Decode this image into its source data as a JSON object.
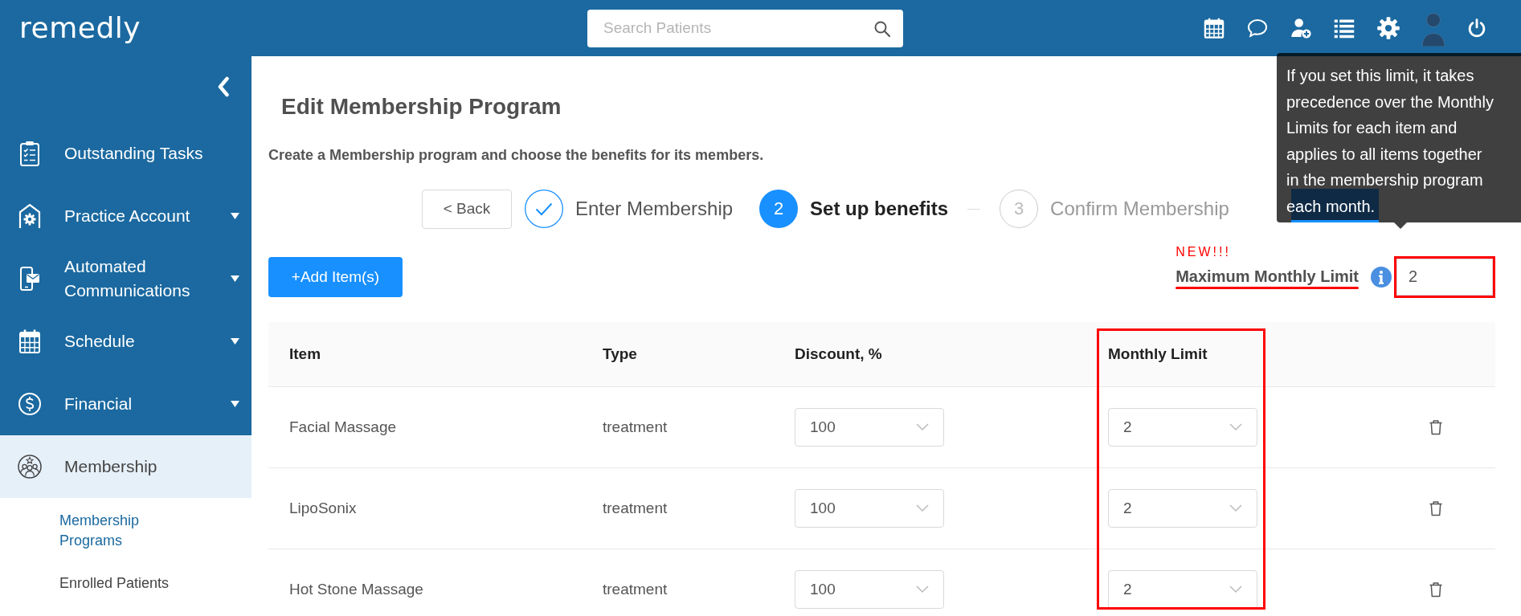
{
  "header": {
    "logo": "remedly",
    "search": {
      "placeholder": "Search Patients"
    }
  },
  "sidebar": {
    "items": [
      {
        "label": "Outstanding Tasks",
        "selected": false,
        "expandable": false
      },
      {
        "label": "Practice Account",
        "selected": false,
        "expandable": true
      },
      {
        "label": "Automated Communications",
        "selected": false,
        "expandable": true
      },
      {
        "label": "Schedule",
        "selected": false,
        "expandable": true
      },
      {
        "label": "Financial",
        "selected": false,
        "expandable": true
      },
      {
        "label": "Membership",
        "selected": true,
        "expandable": false,
        "children": [
          {
            "label": "Membership Programs",
            "selected": true
          },
          {
            "label": "Enrolled Patients",
            "selected": false
          }
        ]
      }
    ]
  },
  "page": {
    "title": "Edit Membership Program",
    "subtitle": "Create a Membership program and choose the benefits for its members.",
    "back_button": "< Back",
    "steps": [
      {
        "label": "Enter Membership",
        "completed": true,
        "selected": false
      },
      {
        "number": "2",
        "label": "Set up benefits",
        "completed": false,
        "selected": true
      },
      {
        "number": "3",
        "label": "Confirm Membership",
        "completed": false,
        "selected": false
      }
    ],
    "add_button": "+Add Item(s)",
    "max_limit": {
      "badge": "NEW!!!",
      "label": "Maximum Monthly Limit",
      "value": "2",
      "highlighted": true
    },
    "tooltip": "If you set this limit, it takes precedence over the Monthly Limits for each item and applies to all items together in the membership program each month.",
    "table": {
      "columns": [
        {
          "label": "Item",
          "highlighted": false
        },
        {
          "label": "Type",
          "highlighted": false
        },
        {
          "label": "Discount, %",
          "highlighted": false
        },
        {
          "label": "Monthly Limit",
          "highlighted": true
        }
      ],
      "rows": [
        {
          "item": "Facial Massage",
          "type": "treatment",
          "discount": "100",
          "monthly_limit": "2"
        },
        {
          "item": "LipoSonix",
          "type": "treatment",
          "discount": "100",
          "monthly_limit": "2"
        },
        {
          "item": "Hot Stone Massage",
          "type": "treatment",
          "discount": "100",
          "monthly_limit": "2"
        }
      ]
    }
  }
}
